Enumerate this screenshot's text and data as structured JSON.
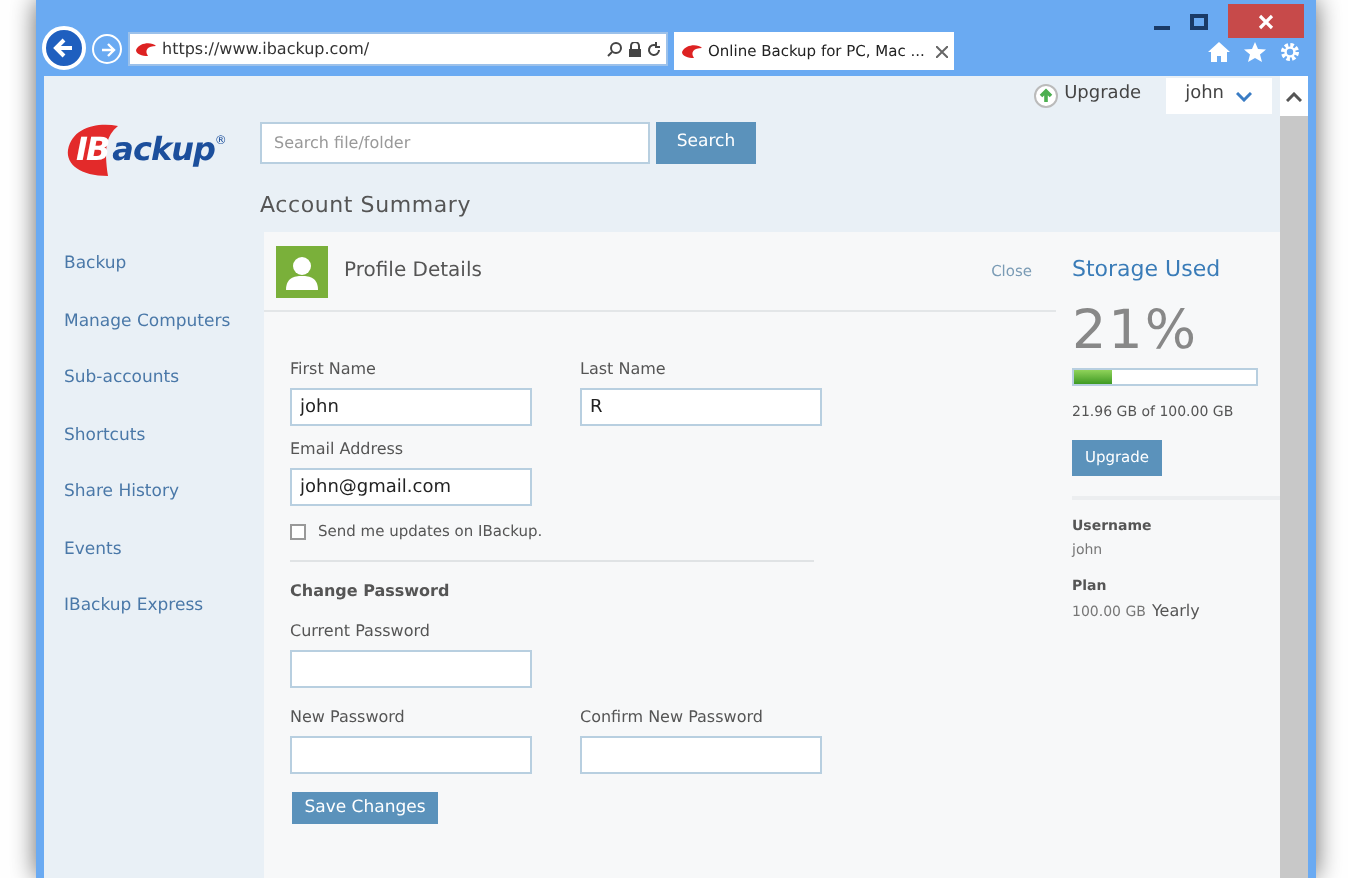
{
  "browser": {
    "address": "https://www.ibackup.com/",
    "tab_title": "Online Backup for PC, Mac ..."
  },
  "top_bar": {
    "upgrade": "Upgrade",
    "user": "john"
  },
  "logo": {
    "part_1": "IB",
    "part_2": "ackup",
    "mark": "®"
  },
  "search": {
    "placeholder": "Search file/folder",
    "button": "Search"
  },
  "page_title": "Account Summary",
  "sidebar": {
    "items": [
      {
        "label": "Backup"
      },
      {
        "label": "Manage Computers"
      },
      {
        "label": "Sub-accounts"
      },
      {
        "label": "Shortcuts"
      },
      {
        "label": "Share History"
      },
      {
        "label": "Events"
      },
      {
        "label": "IBackup Express"
      }
    ]
  },
  "profile": {
    "title": "Profile Details",
    "close": "Close",
    "first_name": {
      "label": "First Name",
      "value": "john"
    },
    "last_name": {
      "label": "Last Name",
      "value": "R"
    },
    "email": {
      "label": "Email Address",
      "value": "john@gmail.com"
    },
    "updates": {
      "label": "Send me updates on IBackup.",
      "checked": false
    },
    "change_password": "Change Password",
    "current_password": {
      "label": "Current Password"
    },
    "new_password": {
      "label": "New Password"
    },
    "confirm_password": {
      "label": "Confirm New Password"
    },
    "save": "Save Changes"
  },
  "storage": {
    "title": "Storage Used",
    "percent": "21%",
    "level": 0.21,
    "usage": "21.96 GB of 100.00 GB",
    "button": "Upgrade",
    "username_label": "Username",
    "username": "john",
    "plan_label": "Plan",
    "plan_size": "100.00 GB",
    "plan_term": "Yearly"
  }
}
